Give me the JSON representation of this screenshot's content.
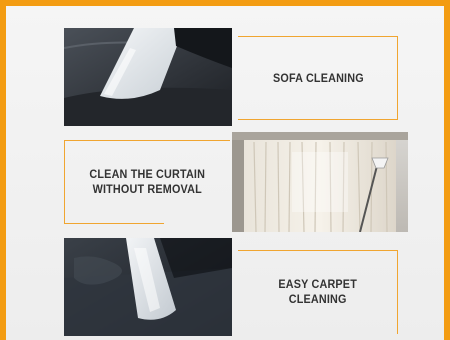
{
  "panels": [
    {
      "label": "SOFA CLEANING",
      "image": "sofa-cleaning-photo"
    },
    {
      "label_lines": [
        "CLEAN THE CURTAIN",
        "WITHOUT REMOVAL"
      ],
      "image": "curtain-cleaning-photo"
    },
    {
      "label_lines": [
        "EASY CARPET",
        "CLEANING"
      ],
      "image": "carpet-cleaning-photo"
    }
  ],
  "colors": {
    "frame": "#f39c12",
    "bracket": "#f0a530",
    "label_text": "#333333",
    "background": "#f2f2f2"
  }
}
